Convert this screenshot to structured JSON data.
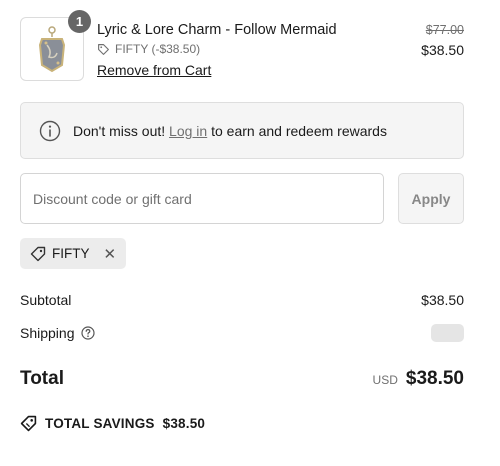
{
  "cart_item": {
    "quantity": "1",
    "title": "Lyric & Lore Charm - Follow Mermaid",
    "discount_code_line": "FIFTY (-$38.50)",
    "remove_label": "Remove from Cart",
    "original_price": "$77.00",
    "price": "$38.50",
    "image_icon": "charm-pendant-icon"
  },
  "notice": {
    "icon": "info-icon",
    "prefix": "Don't miss out! ",
    "link_label": "Log in",
    "suffix": " to earn and redeem rewards"
  },
  "discount": {
    "placeholder": "Discount code or gift card",
    "value": "",
    "apply_label": "Apply"
  },
  "applied_codes": [
    {
      "code": "FIFTY",
      "icon": "tag-icon",
      "remove_icon": "close-icon"
    }
  ],
  "summary": {
    "subtotal_label": "Subtotal",
    "subtotal_value": "$38.50",
    "shipping_label": "Shipping",
    "shipping_help_icon": "question-circle-icon",
    "total_label": "Total",
    "currency": "USD",
    "total_value": "$38.50",
    "savings_label": "TOTAL SAVINGS",
    "savings_value": "$38.50"
  },
  "colors": {
    "text": "#1a1a1a",
    "muted": "#707070",
    "panel": "#f5f5f5",
    "badge": "#666666"
  }
}
